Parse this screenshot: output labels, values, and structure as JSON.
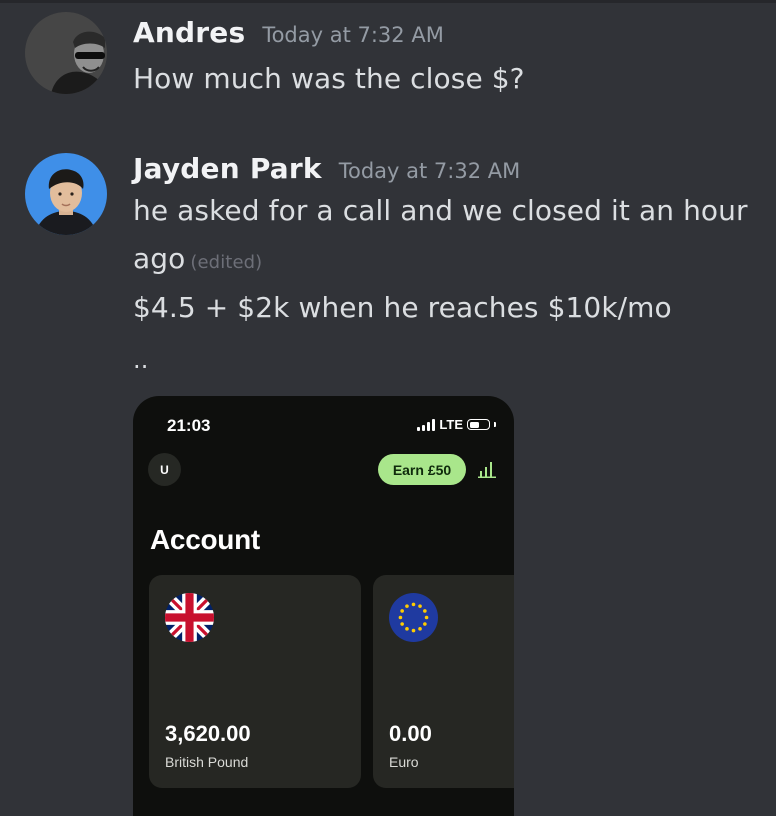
{
  "messages": [
    {
      "author": "Andres",
      "timestamp": "Today at 7:32 AM",
      "lines": [
        "How much was the close $?"
      ],
      "avatar_icon": "person-sunglasses-avatar-icon"
    },
    {
      "author": "Jayden Park",
      "timestamp": "Today at 7:32 AM",
      "lines": [
        "he asked for a call and we closed it an hour",
        "ago",
        "$4.5 + $2k when he reaches $10k/mo",
        ".."
      ],
      "edited_label": "(edited)",
      "avatar_icon": "person-portrait-avatar-icon"
    }
  ],
  "attachment": {
    "status_time": "21:03",
    "network": "LTE",
    "user_initial": "U",
    "earn_label": "Earn £50",
    "screen_title": "Account",
    "accounts": [
      {
        "amount": "3,620.00",
        "currency": "British Pound",
        "flag_icon": "uk-flag-icon"
      },
      {
        "amount": "0.00",
        "currency": "Euro",
        "flag_icon": "eu-flag-icon"
      }
    ],
    "colors": {
      "earn_pill": "#a9e68b",
      "stats_icon": "#a9e68b",
      "app_background": "#0e0f0d"
    }
  },
  "colors": {
    "chat_background": "#313338",
    "username": "#f2f3f5",
    "timestamp": "#949ba4",
    "message_text": "#dbdee1"
  }
}
